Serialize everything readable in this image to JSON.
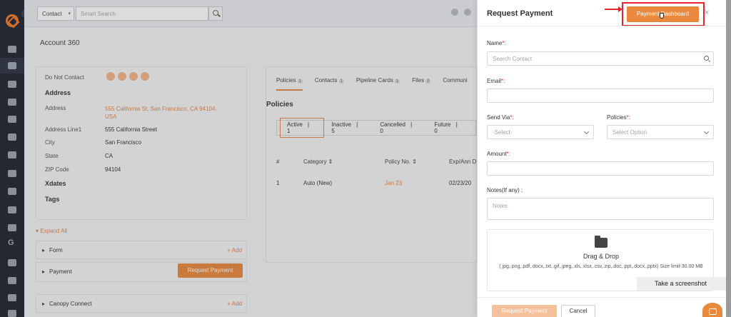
{
  "topbar": {
    "context_select": "Contact",
    "search_placeholder": "Smart Search"
  },
  "page": {
    "title": "Account 360"
  },
  "account_card": {
    "do_not_contact_label": "Do Not Contact",
    "address_heading": "Address",
    "rows": [
      {
        "label": "Address",
        "value": "555 California St, San Francisco, CA 94104, USA"
      },
      {
        "label": "Address Line1",
        "value": "555 California Street"
      },
      {
        "label": "City",
        "value": "San Francisco"
      },
      {
        "label": "State",
        "value": "CA"
      },
      {
        "label": "ZIP Code",
        "value": "94104"
      }
    ],
    "xdates_heading": "Xdates",
    "tags_heading": "Tags"
  },
  "accordion": {
    "expand_all": "Expand All",
    "form_label": "Form",
    "form_add": "+ Add",
    "payment_label": "Payment",
    "request_payment_label": "Request Payment",
    "canopy_label": "Canopy Connect",
    "canopy_add": "+ Add"
  },
  "policies_panel": {
    "tabs": [
      {
        "label": "Policies",
        "count": "1"
      },
      {
        "label": "Contacts",
        "count": "1"
      },
      {
        "label": "Pipeline Cards",
        "count": "1"
      },
      {
        "label": "Files",
        "count": "0"
      },
      {
        "label": "Communi",
        "count": ""
      }
    ],
    "heading": "Policies",
    "status": [
      {
        "label": "Active",
        "count": "1"
      },
      {
        "label": "Inactive",
        "count": "5"
      },
      {
        "label": "Cancelled",
        "count": "0"
      },
      {
        "label": "Future",
        "count": "0"
      }
    ],
    "columns": [
      "#",
      "Category ⇕",
      "Policy No. ⇕",
      "Exp/Ann D"
    ],
    "rows": [
      {
        "num": "1",
        "category": "Auto (New)",
        "policy_no": "Jan 23",
        "date": "02/23/20"
      }
    ]
  },
  "modal": {
    "title": "Request Payment",
    "payment_dashboard_label": "Payment Dashboard",
    "close_label": "×",
    "name_label": "Name",
    "name_required": "*:",
    "name_placeholder": "Search Contact",
    "email_label": "Email",
    "email_required": "*:",
    "send_via_label": "Send Via",
    "send_via_required": "*:",
    "send_via_value": "-Select-",
    "policies_label": "Policies",
    "policies_required": "*:",
    "policies_value": "Select Option",
    "amount_label": "Amount",
    "amount_required": "*:",
    "notes_label": "Notes(If any) :",
    "notes_placeholder": "Notes",
    "drag_drop_title": "Drag & Drop",
    "drag_drop_desc": "(.jpg,.png,.pdf,.docx,.txt,.gif,.jpeg,.xls,.xlsx,.csv,.zip,.doc,.ppt,.docx,.pptx) Size limit-30.00 MB",
    "submit_label": "Request Payment",
    "cancel_label": "Cancel"
  },
  "toast": {
    "text": "Take a screenshot"
  },
  "colors": {
    "accent": "#e8893d",
    "highlight": "#e3262e",
    "sidebar_bg": "#1f2430"
  }
}
